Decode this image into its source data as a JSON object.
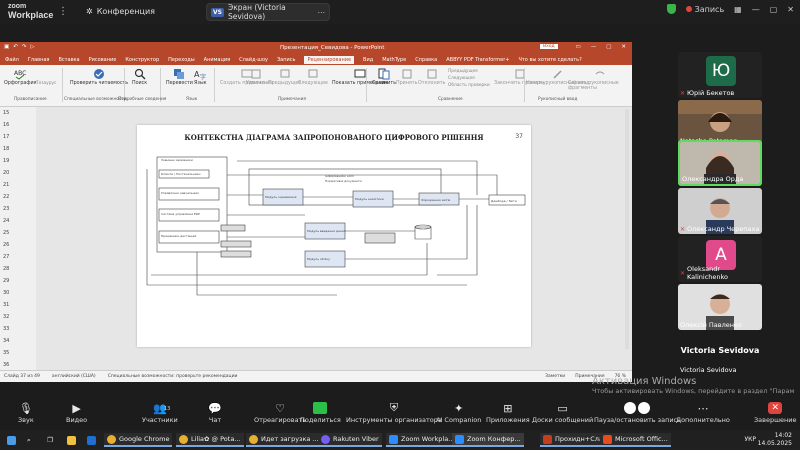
{
  "zoom": {
    "app_line1": "zoom",
    "app_line2": "Workplace",
    "meeting_title": "Конференция",
    "screen_share": "Экран (Victoria Sevidova)",
    "record_label": "Запись"
  },
  "ppt": {
    "window_title": "Презентация_Севидова  -  PowerPoint",
    "login": "Вход",
    "tabs": [
      "Файл",
      "Главная",
      "Вставка",
      "Рисование",
      "Конструктор",
      "Переходы",
      "Анимация",
      "Слайд-шоу",
      "Запись",
      "Рецензирование",
      "Вид",
      "MathType",
      "Справка",
      "ABBYY PDF Transformer+",
      "Что вы хотите сделать?"
    ],
    "active_tab": "Рецензирование",
    "ribbon": {
      "spelling": "Орфография",
      "thesaurus": "Тезаурус",
      "check_access": "Проверить читаемость",
      "smart_lookup": "Поиск",
      "translate": "Перевести",
      "language": "Язык",
      "new_comment": "Создать примечание",
      "delete": "Удалить",
      "prev": "Предыдущее",
      "next": "Следующее",
      "show_comments": "Показать примечания",
      "compare": "Сравнить",
      "accept": "Принять",
      "reject": "Отклонить",
      "prev2": "Предыдущее",
      "next2": "Следующее",
      "reviewing_pane": "Область проверки",
      "end_review": "Закончить проверку",
      "start_inking": "Начать рукописный ввод",
      "hide_ink": "Скрыть рукописные фрагменты",
      "g_spelling": "Правописание",
      "g_access": "Специальные возможности",
      "g_insights": "Подробные сведения",
      "g_language": "Язык",
      "g_comments": "Примечания",
      "g_compare": "Сравнение",
      "g_ink": "Рукописный ввод"
    },
    "thumbs": [
      "15",
      "16",
      "17",
      "18",
      "19",
      "20",
      "21",
      "22",
      "23",
      "24",
      "25",
      "26",
      "27",
      "28",
      "29",
      "30",
      "31",
      "32",
      "33",
      "34",
      "35",
      "36"
    ],
    "slide": {
      "title": "КОНТЕКСТНА ДІАГРАМА ЗАПРОПОНОВАНОГО ЦИФРОВОГО РІШЕННЯ",
      "number": "37"
    },
    "status": {
      "slide": "Слайд 37 из 49",
      "lang": "английский (США)",
      "access": "Специальные возможности: проверьте рекомендации",
      "notes": "Заметки",
      "comments": "Примечания",
      "zoom": "76 %"
    }
  },
  "participants": [
    {
      "name": "Юрій Бекетов",
      "initials": "Ю",
      "color": "#1e6b4a",
      "muted": true
    },
    {
      "name": "Natasha Potaman",
      "muted": false
    },
    {
      "name": "Олександра Орда",
      "muted": false,
      "active": true
    },
    {
      "name": "Олександр Черепаха",
      "muted": true
    },
    {
      "name": "Oleksandr Kalinichenko",
      "initials": "A",
      "color": "#e04a8a",
      "muted": true
    },
    {
      "name": "Олексій Павленко",
      "muted": false
    }
  ],
  "presenter": {
    "big": "Victoria Sevidova",
    "small": "Victoria Sevidova"
  },
  "activation": {
    "heading": "Активация Windows",
    "sub": "Чтобы активировать Windows, перейдите в раздел \"Парам"
  },
  "toolbar": {
    "audio": "Звук",
    "video": "Видео",
    "participants": "Участники",
    "participants_count": "13",
    "chat": "Чат",
    "react": "Отреагировать",
    "share": "Поделиться",
    "host_tools": "Инструменты организатора",
    "ai": "AI Companion",
    "apps": "Приложения",
    "whiteboards": "Доски сообщений",
    "pause_rec": "Пауза/остановить запись",
    "more": "Дополнительно",
    "end": "Завершение"
  },
  "taskbar": {
    "items": [
      "Google Chrome",
      "Lilia✿ @ Pota...",
      "Идет загрузка ...",
      "Rakuten Viber",
      "Zoom Workpla...",
      "Zoom Конфер...",
      "Прохидн+Сла...",
      "Microsoft Offic..."
    ],
    "lang": "УКР",
    "time": "14:02",
    "date": "14.05.2025"
  }
}
